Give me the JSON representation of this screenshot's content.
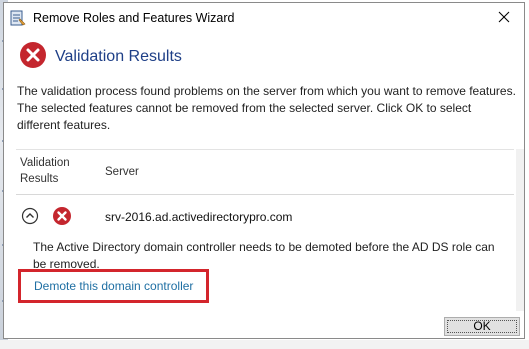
{
  "window": {
    "title": "Remove Roles and Features Wizard"
  },
  "header": {
    "title": "Validation Results"
  },
  "message": "The validation process found problems on the server from which you want to remove features. The selected features cannot be removed from the selected server.  Click OK to select different features.",
  "grid": {
    "columns": [
      "Validation Results",
      "Server"
    ],
    "row": {
      "server": "srv-2016.ad.activedirectorypro.com",
      "detail": "The Active Directory domain controller needs to be demoted before the AD DS role can be removed.",
      "action_link": "Demote this domain controller"
    }
  },
  "buttons": {
    "ok": "OK"
  },
  "colors": {
    "header_title": "#1e3f87",
    "error_icon": "#c4262e",
    "link": "#1f6fa3",
    "highlight": "#d3252c"
  },
  "icons": {
    "app": "wizard-icon",
    "header": "error-icon",
    "close": "close-icon",
    "collapse": "chevron-up-icon",
    "row_status": "error-icon"
  }
}
